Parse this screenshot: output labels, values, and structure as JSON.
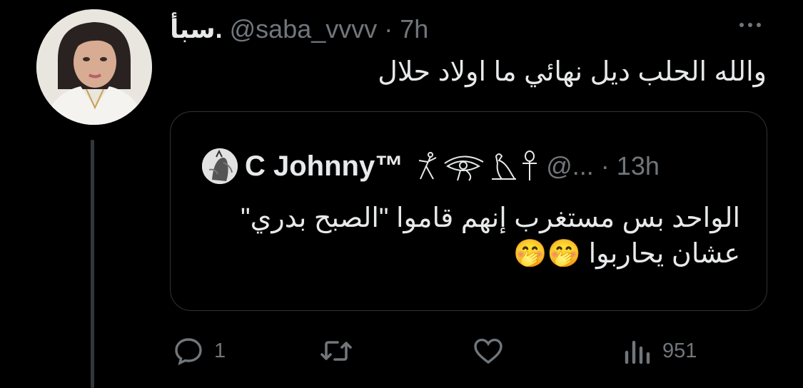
{
  "tweet": {
    "display_name": "سبأ.",
    "handle": "@saba_vvvv",
    "separator": "·",
    "time": "7h",
    "text": "والله الحلب ديل نهائي ما اولاد حلال"
  },
  "quote": {
    "display_name": "C Johnny™",
    "handle": "@...",
    "separator": "·",
    "time": "13h",
    "text": "الواحد بس مستغرب إنهم قاموا \"الصبح بدري\" عشان يحاربوا 🤭🤭",
    "name_symbols": [
      "dancer-glyph-icon",
      "eye-of-horus-icon",
      "falcon-glyph-icon",
      "ankh-icon"
    ]
  },
  "actions": {
    "reply_count": "1",
    "retweet_count": "",
    "like_count": "",
    "views_count": "951"
  },
  "colors": {
    "background": "#000000",
    "text": "#e7e9ea",
    "secondary": "#71767b",
    "border": "#2f3336"
  }
}
